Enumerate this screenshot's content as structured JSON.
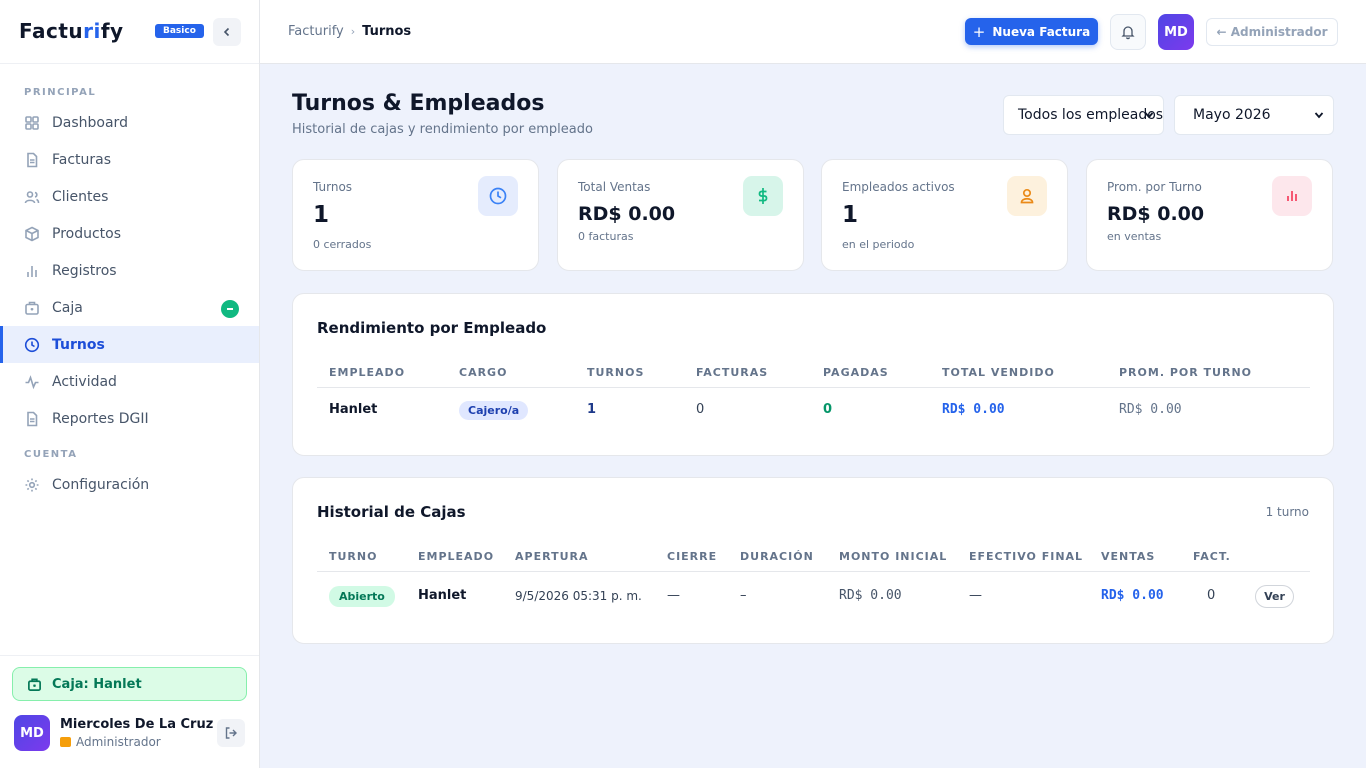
{
  "app": {
    "logo_part1": "Factu",
    "logo_part2": "ri",
    "logo_part3": "fy",
    "plan": "Basico"
  },
  "sidebar": {
    "section_principal": "PRINCIPAL",
    "section_cuenta": "CUENTA",
    "items": [
      {
        "label": "Dashboard",
        "icon": "grid-icon"
      },
      {
        "label": "Facturas",
        "icon": "file-icon"
      },
      {
        "label": "Clientes",
        "icon": "users-icon"
      },
      {
        "label": "Productos",
        "icon": "box-icon"
      },
      {
        "label": "Registros",
        "icon": "bar-chart-icon"
      },
      {
        "label": "Caja",
        "icon": "briefcase-icon"
      },
      {
        "label": "Turnos",
        "icon": "clock-icon",
        "active": true
      },
      {
        "label": "Actividad",
        "icon": "activity-icon"
      },
      {
        "label": "Reportes DGII",
        "icon": "file-icon"
      }
    ],
    "account_items": [
      {
        "label": "Configuración",
        "icon": "gear-icon"
      }
    ],
    "caja_status": "Caja: Hanlet",
    "user": {
      "initials": "MD",
      "name": "Miercoles De La Cruz",
      "role": "Administrador"
    }
  },
  "topbar": {
    "crumb_root": "Facturify",
    "crumb_sep": "›",
    "crumb_current": "Turnos",
    "new_invoice": "Nueva Factura",
    "new_invoice_plus": "+",
    "avatar": "MD",
    "admin_label": "← Administrador"
  },
  "page": {
    "title": "Turnos & Empleados",
    "subtitle": "Historial de cajas y rendimiento por empleado",
    "employee_filter": "Todos los empleados",
    "period_filter": "Mayo 2026"
  },
  "stats": [
    {
      "label": "Turnos",
      "value": "1",
      "sub": "0 cerrados",
      "icon": "clock-icon",
      "color": "#3b82f6",
      "bg": "#e5ecfd"
    },
    {
      "label": "Total Ventas",
      "value": "RD$ 0.00",
      "sub": "0 facturas",
      "icon": "dollar-icon",
      "color": "#10b981",
      "bg": "#d7f5ea"
    },
    {
      "label": "Empleados activos",
      "value": "1",
      "sub": "en el periodo",
      "icon": "user-icon",
      "color": "#ea8a18",
      "bg": "#fdf1dd"
    },
    {
      "label": "Prom. por Turno",
      "value": "RD$ 0.00",
      "sub": "en ventas",
      "icon": "bar-chart-icon",
      "color": "#f43f5e",
      "bg": "#fde7ec"
    }
  ],
  "performance": {
    "title": "Rendimiento por Empleado",
    "headers": [
      "EMPLEADO",
      "CARGO",
      "TURNOS",
      "FACTURAS",
      "PAGADAS",
      "TOTAL VENDIDO",
      "PROM. POR TURNO"
    ],
    "rows": [
      {
        "empleado": "Hanlet",
        "cargo": "Cajero/a",
        "turnos": "1",
        "facturas": "0",
        "pagadas": "0",
        "total": "RD$ 0.00",
        "promedio": "RD$ 0.00"
      }
    ]
  },
  "history": {
    "title": "Historial de Cajas",
    "count": "1 turno",
    "headers": [
      "TURNO",
      "EMPLEADO",
      "APERTURA",
      "CIERRE",
      "DURACIÓN",
      "MONTO INICIAL",
      "EFECTIVO FINAL",
      "VENTAS",
      "FACT."
    ],
    "rows": [
      {
        "turno": "Abierto",
        "empleado": "Hanlet",
        "apertura": "9/5/2026 05:31 p. m.",
        "cierre": "—",
        "duracion": "–",
        "monto_inicial": "RD$ 0.00",
        "efectivo_final": "—",
        "ventas": "RD$ 0.00",
        "fact": "0",
        "action": "Ver"
      }
    ]
  },
  "colors": {
    "accent": "#2563eb",
    "success": "#10b981"
  }
}
